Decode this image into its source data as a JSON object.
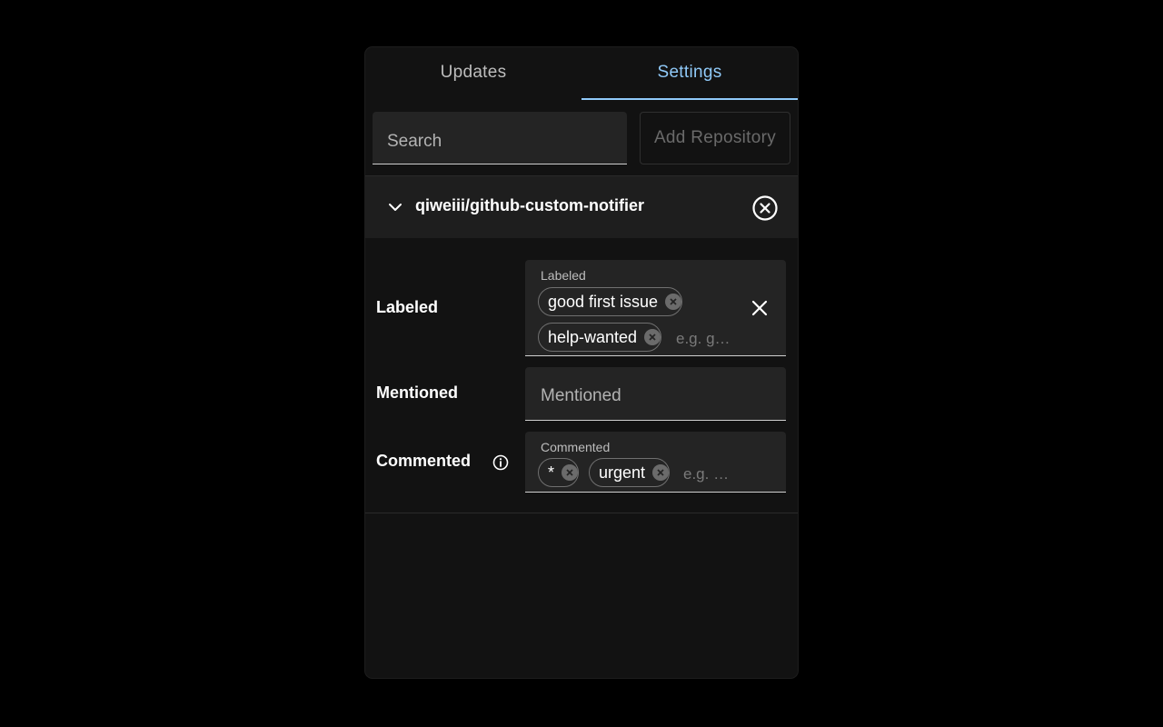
{
  "tabs": [
    {
      "label": "Updates"
    },
    {
      "label": "Settings"
    }
  ],
  "search": {
    "placeholder": "Search"
  },
  "add_button": {
    "label": "Add Repository"
  },
  "repo": {
    "name": "qiweiii/github-custom-notifier",
    "rows": {
      "labeled": {
        "label": "Labeled",
        "field_label": "Labeled",
        "chips": [
          "good first issue",
          "help-wanted"
        ],
        "placeholder": "e.g. g…"
      },
      "mentioned": {
        "label": "Mentioned",
        "placeholder": "Mentioned"
      },
      "commented": {
        "label": "Commented",
        "field_label": "Commented",
        "chips": [
          "*",
          "urgent"
        ],
        "placeholder": "e.g. …"
      }
    }
  },
  "colors": {
    "accent": "#90caf9",
    "background": "#121212",
    "field_bg": "#242424",
    "header_bg": "#1e1e1e"
  },
  "icons": {
    "collapse": "chevron-down-icon",
    "remove_repo": "close-circle-icon",
    "clear_field": "close-icon",
    "chip_delete": "cancel-icon",
    "info": "info-icon"
  }
}
